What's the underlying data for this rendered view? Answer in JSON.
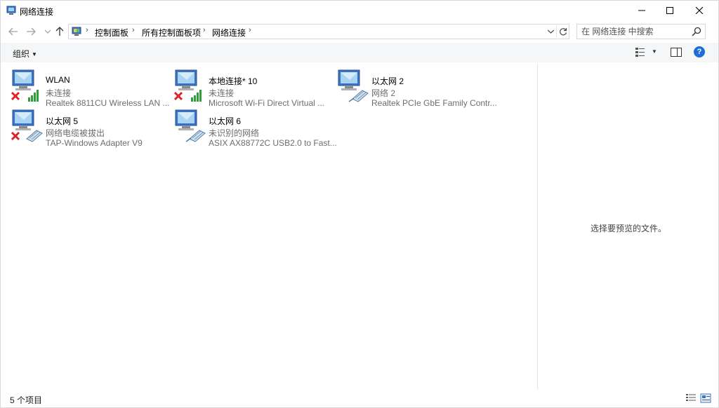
{
  "window": {
    "title": "网络连接"
  },
  "address": {
    "crumbs": [
      "控制面板",
      "所有控制面板项",
      "网络连接"
    ],
    "search_placeholder": "在 网络连接 中搜索"
  },
  "toolbar": {
    "organize_label": "组织",
    "help_label": "?"
  },
  "connections": [
    {
      "name": "WLAN",
      "status": "未连接",
      "device": "Realtek 8811CU Wireless LAN ...",
      "type": "wireless",
      "disconnected": true
    },
    {
      "name": "本地连接* 10",
      "status": "未连接",
      "device": "Microsoft Wi-Fi Direct Virtual ...",
      "type": "wireless",
      "disconnected": true
    },
    {
      "name": "以太网 2",
      "status": "网络 2",
      "device": "Realtek PCIe GbE Family Contr...",
      "type": "ethernet",
      "disconnected": false
    },
    {
      "name": "以太网 5",
      "status": "网络电缆被拔出",
      "device": "TAP-Windows Adapter V9",
      "type": "ethernet",
      "disconnected": true
    },
    {
      "name": "以太网 6",
      "status": "未识别的网络",
      "device": "ASIX AX88772C USB2.0 to Fast...",
      "type": "ethernet",
      "disconnected": false
    }
  ],
  "preview": {
    "message": "选择要预览的文件。"
  },
  "statusbar": {
    "item_count": "5 个项目"
  },
  "colors": {
    "accent": "#1d6ed6",
    "signal_green": "#2e9e3a",
    "error_red": "#d9262b"
  }
}
